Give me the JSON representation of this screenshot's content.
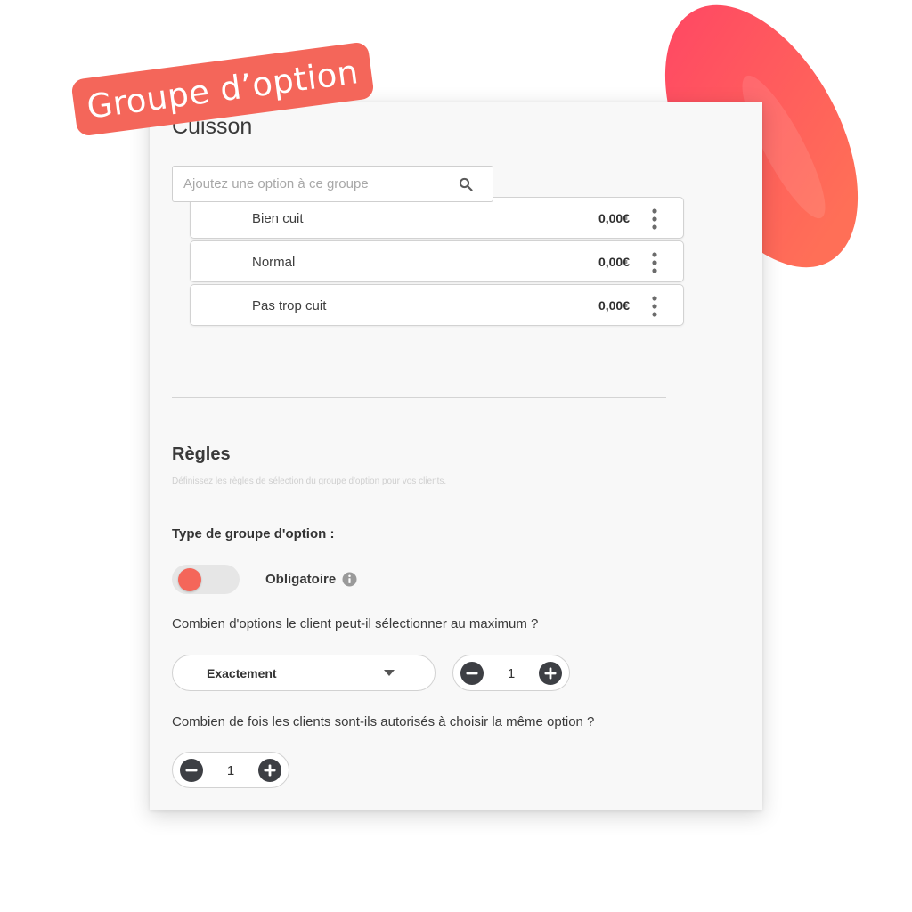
{
  "badge": {
    "label": "Groupe d’option"
  },
  "group": {
    "title": "Cuisson",
    "search_placeholder": "Ajoutez une option à ce groupe",
    "options": [
      {
        "name": "Bien cuit",
        "price": "0,00€"
      },
      {
        "name": "Normal",
        "price": "0,00€"
      },
      {
        "name": "Pas trop cuit",
        "price": "0,00€"
      }
    ]
  },
  "rules": {
    "title": "Règles",
    "description": "Définissez les règles de sélection du groupe d'option pour vos clients.",
    "type_label": "Type de groupe d'option :",
    "required_label": "Obligatoire",
    "required_on": true,
    "max_question": "Combien d'options le client peut-il sélectionner au maximum ?",
    "mode_value": "Exactement",
    "max_count": "1",
    "repeat_question": "Combien de fois les clients sont-ils autorisés à choisir la même option ?",
    "repeat_count": "1"
  },
  "colors": {
    "accent": "#f4665a",
    "accent_gradient_top": "#ff4a63",
    "accent_gradient_bottom": "#ff6e58",
    "card_bg": "#f8f8f8",
    "icon_dark": "#3d3f44"
  }
}
